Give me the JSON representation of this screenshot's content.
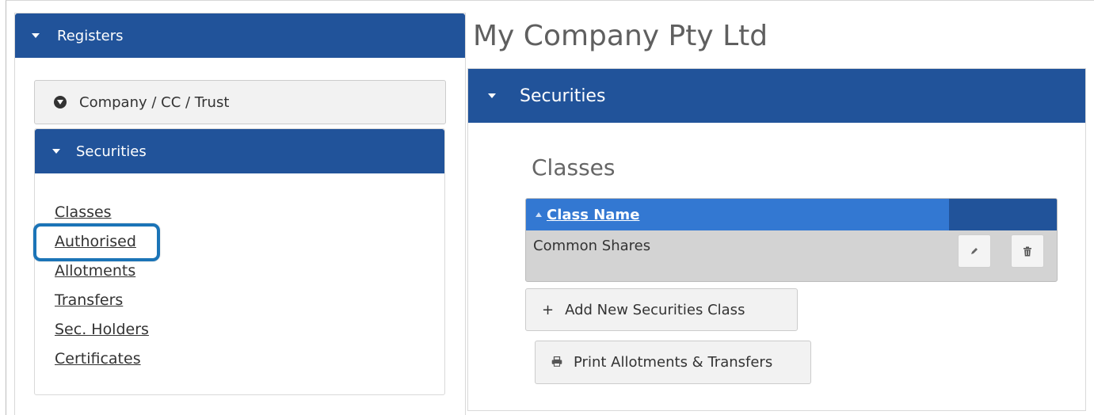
{
  "left_panel": {
    "header": "Registers",
    "company_button": "Company / CC / Trust",
    "securities_header": "Securities",
    "links": [
      "Classes",
      "Authorised",
      "Allotments",
      "Transfers",
      "Sec. Holders",
      "Certificates"
    ]
  },
  "main": {
    "company_name": "My Company Pty Ltd",
    "section_header": "Securities",
    "classes_heading": "Classes",
    "grid": {
      "column_header": "Class Name",
      "rows": [
        {
          "name": "Common Shares"
        }
      ]
    },
    "add_button": "Add New Securities Class",
    "print_button": "Print Allotments & Transfers"
  },
  "colors": {
    "panel_header": "#21539a",
    "grid_header": "#3378d2",
    "highlight_ring": "#1b74b7"
  },
  "icons": {
    "add": "plus-icon",
    "print": "print-icon",
    "edit": "pencil-icon",
    "delete": "trash-icon"
  }
}
